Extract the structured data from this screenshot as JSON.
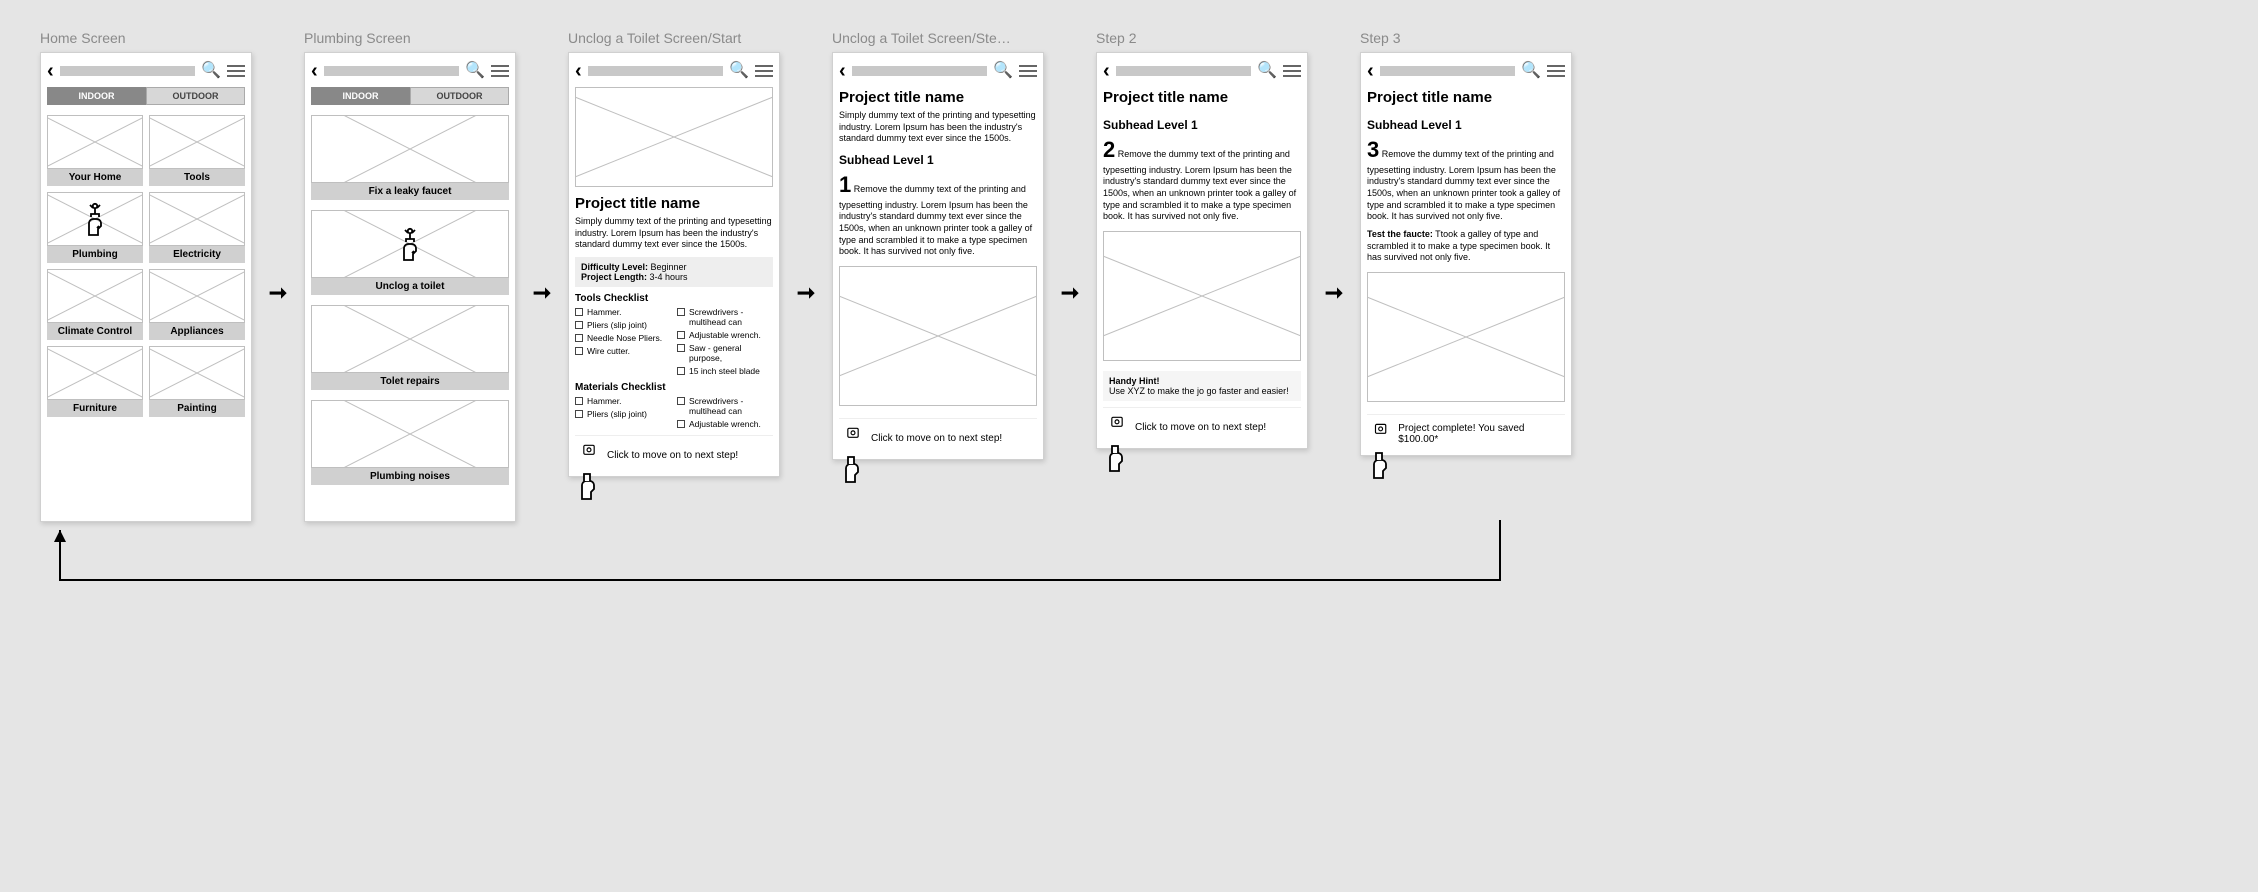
{
  "screens": {
    "home": {
      "label": "Home Screen",
      "tabs": {
        "indoor": "INDOOR",
        "outdoor": "OUTDOOR"
      },
      "tiles": [
        "Your Home",
        "Tools",
        "Plumbing",
        "Electricity",
        "Climate Control",
        "Appliances",
        "Furniture",
        "Painting"
      ]
    },
    "plumbing": {
      "label": "Plumbing Screen",
      "tabs": {
        "indoor": "INDOOR",
        "outdoor": "OUTDOOR"
      },
      "items": [
        "Fix a leaky faucet",
        "Unclog a toilet",
        "Tolet repairs",
        "Plumbing noises"
      ]
    },
    "start": {
      "label": "Unclog a Toilet Screen/Start",
      "title": "Project title name",
      "desc": "Simply dummy text of the printing and typesetting industry. Lorem Ipsum has been the industry's standard dummy text ever since the 1500s.",
      "diff_label": "Difficulty Level:",
      "diff_val": " Beginner",
      "len_label": "Project Length:",
      "len_val": " 3-4 hours",
      "tools_head": "Tools Checklist",
      "tools_a": [
        "Hammer.",
        "Pliers (slip joint)",
        "Needle Nose Pliers.",
        "Wire cutter."
      ],
      "tools_b": [
        "Screwdrivers - multihead can",
        "Adjustable wrench.",
        "Saw - general purpose,",
        "15 inch steel blade"
      ],
      "mats_head": "Materials Checklist",
      "mats_a": [
        "Hammer.",
        "Pliers (slip joint)"
      ],
      "mats_b": [
        "Screwdrivers - multihead can",
        "Adjustable wrench."
      ],
      "next": "Click to move on to next step!"
    },
    "step1": {
      "label": "Unclog a Toilet Screen/Ste…",
      "title": "Project title name",
      "desc": "Simply dummy text of the printing and typesetting industry. Lorem Ipsum has been the industry's standard dummy text ever since the 1500s.",
      "subhead": "Subhead Level 1",
      "num": "1",
      "body": "Remove the  dummy text of the printing and typesetting industry. Lorem Ipsum has been the industry's standard dummy text ever since the 1500s, when an unknown printer took a galley of type and scrambled it to make a type specimen book. It has survived not only five.",
      "next": "Click to move on to next step!"
    },
    "step2": {
      "label": "Step 2",
      "title": "Project title name",
      "subhead": "Subhead Level 1",
      "num": "2",
      "body": "Remove the  dummy text of the printing and typesetting industry. Lorem Ipsum has been the industry's standard dummy text ever since the 1500s, when an unknown printer took a galley of type and scrambled it to make a type specimen book. It has survived not only five.",
      "hint_head": "Handy Hint!",
      "hint_body": "Use XYZ to make the jo go faster and easier!",
      "next": "Click to move on to next step!"
    },
    "step3": {
      "label": "Step 3",
      "title": "Project title name",
      "subhead": "Subhead Level 1",
      "num": "3",
      "body": "Remove the  dummy text of the printing and typesetting industry. Lorem Ipsum has been the industry's standard dummy text ever since the 1500s, when an unknown printer took a galley of type and scrambled it to make a type specimen book. It has survived not only five.",
      "test_label": "Test the faucte:",
      "test_body": "  Ttook a galley of type and scrambled it to make a type specimen book. It has survived not only five.",
      "next": "Project complete! You saved $100.00*"
    }
  }
}
